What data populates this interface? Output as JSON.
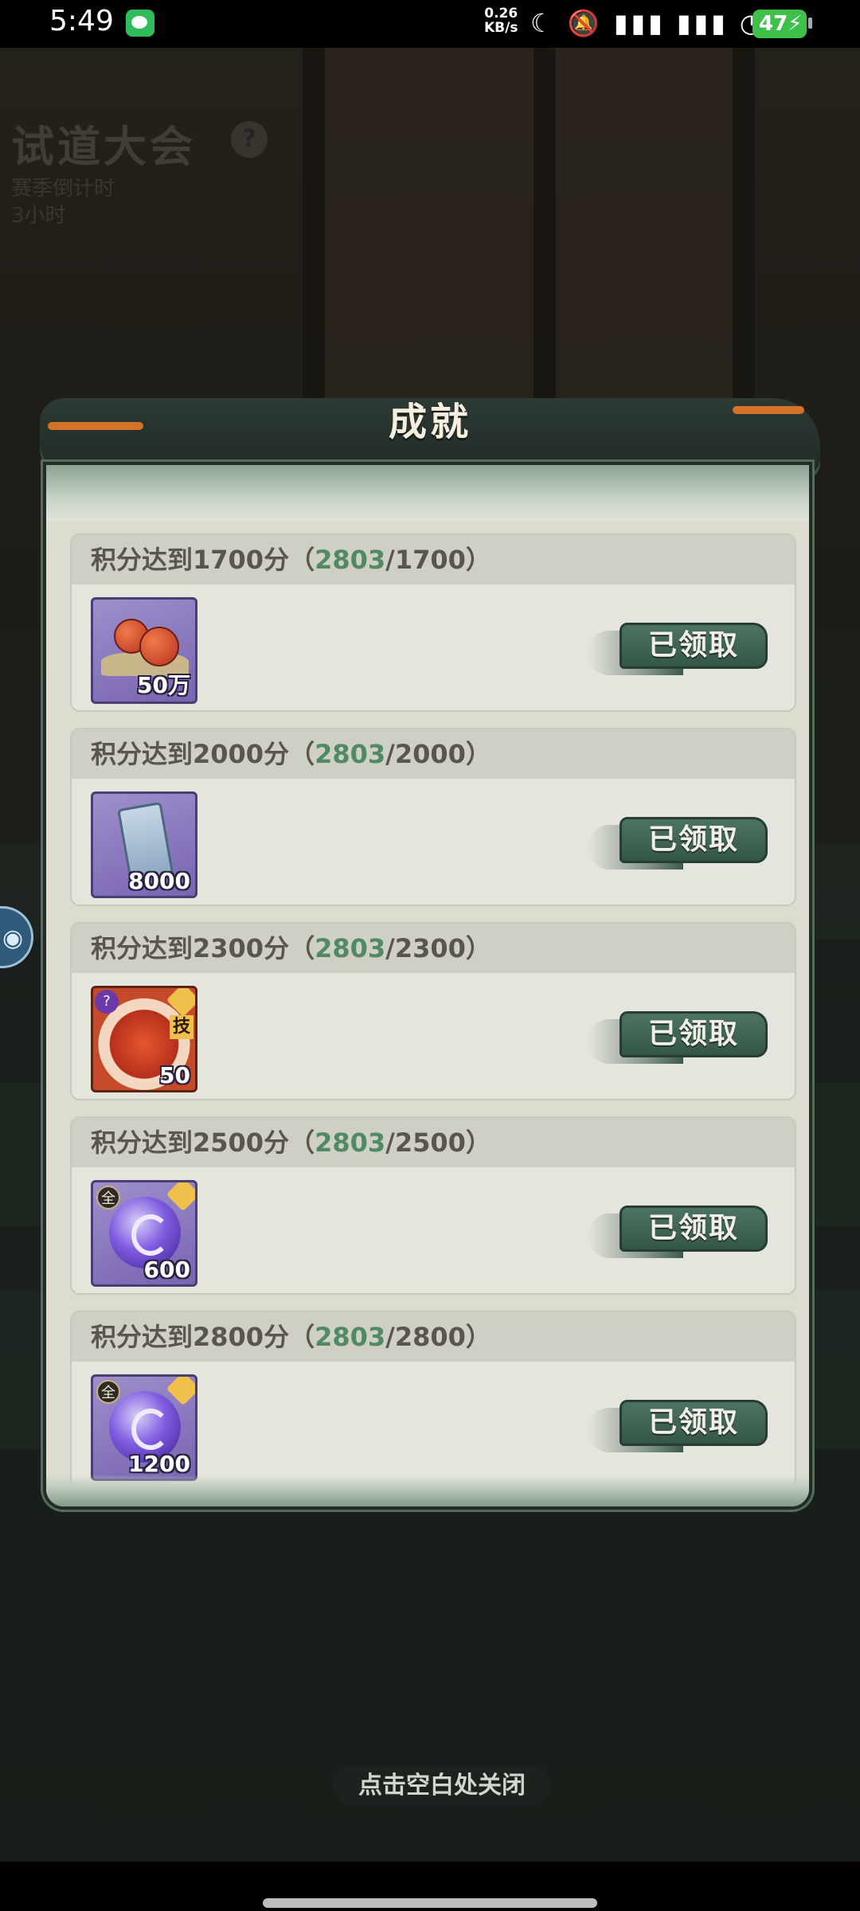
{
  "status_bar": {
    "time": "5:49",
    "net_speed_value": "0.26",
    "net_speed_unit": "KB/s",
    "icons": [
      "wechat-icon",
      "moon-icon",
      "mute-icon",
      "signal-icon",
      "signal-icon",
      "wifi-icon"
    ],
    "battery": "47"
  },
  "background": {
    "title": "试道大会",
    "help": "?",
    "countdown_label": "赛季倒计时",
    "countdown_value": "3小时"
  },
  "modal": {
    "title": "成就",
    "close_hint": "点击空白处关闭",
    "items": [
      {
        "label_prefix": "积分达到1700分（",
        "current": "2803",
        "label_suffix": "/1700）",
        "quantity": "50万",
        "claim_label": "已领取",
        "icon": "gourd-money-icon"
      },
      {
        "label_prefix": "积分达到2000分（",
        "current": "2803",
        "label_suffix": "/2000）",
        "quantity": "8000",
        "claim_label": "已领取",
        "icon": "jade-tablet-icon"
      },
      {
        "label_prefix": "积分达到2300分（",
        "current": "2803",
        "label_suffix": "/2300）",
        "quantity": "50",
        "claim_label": "已领取",
        "icon": "skill-monster-icon",
        "badge": "技"
      },
      {
        "label_prefix": "积分达到2500分（",
        "current": "2803",
        "label_suffix": "/2500）",
        "quantity": "600",
        "claim_label": "已领取",
        "icon": "spirit-orb-icon",
        "badge": "全"
      },
      {
        "label_prefix": "积分达到2800分（",
        "current": "2803",
        "label_suffix": "/2800）",
        "quantity": "1200",
        "claim_label": "已领取",
        "icon": "spirit-orb-icon",
        "badge": "全"
      }
    ]
  },
  "colors": {
    "highlight": "#4f8a62",
    "claim_button": "#3f6352",
    "card_bg": "#e6e5dd"
  }
}
